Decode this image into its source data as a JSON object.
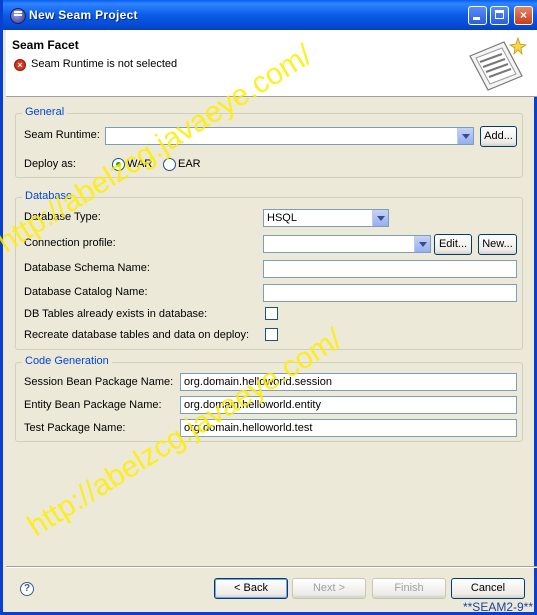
{
  "window": {
    "title": "New Seam Project",
    "minimize": "",
    "maximize": "",
    "close": "×"
  },
  "header": {
    "title": "Seam Facet",
    "error_message": "Seam Runtime is not selected",
    "error_icon": "error-icon",
    "banner_icon": "wizard-banner-icon"
  },
  "general": {
    "legend": "General",
    "seam_runtime_label": "Seam Runtime:",
    "seam_runtime_value": "",
    "add_button": "Add...",
    "deploy_as_label": "Deploy as:",
    "options": [
      "WAR",
      "EAR"
    ],
    "selected": "WAR"
  },
  "database": {
    "legend": "Database",
    "type_label": "Database Type:",
    "type_value": "HSQL",
    "connection_label": "Connection profile:",
    "connection_value": "",
    "edit_button": "Edit...",
    "new_button": "New...",
    "schema_label": "Database Schema Name:",
    "schema_value": "",
    "catalog_label": "Database Catalog Name:",
    "catalog_value": "",
    "tables_exist_label": "DB Tables already exists in database:",
    "tables_exist_checked": false,
    "recreate_label": "Recreate database tables and data on deploy:",
    "recreate_checked": false
  },
  "codegen": {
    "legend": "Code Generation",
    "session_label": "Session Bean Package Name:",
    "session_value": "org.domain.helloworld.session",
    "entity_label": "Entity Bean Package Name:",
    "entity_value": "org.domain.helloworld.entity",
    "test_label": "Test Package Name:",
    "test_value": "org.domain.helloworld.test"
  },
  "footer": {
    "help_icon": "?",
    "back": "< Back",
    "next": "Next >",
    "finish": "Finish",
    "cancel": "Cancel"
  },
  "watermark": {
    "text": "http://abelzcg.javaeye.com/",
    "tag": "**SEAM2-9**"
  },
  "colors": {
    "title_bar": "#0a5ce6",
    "legend": "#0046d5",
    "error": "#d9341c",
    "watermark": "#ffee00"
  }
}
